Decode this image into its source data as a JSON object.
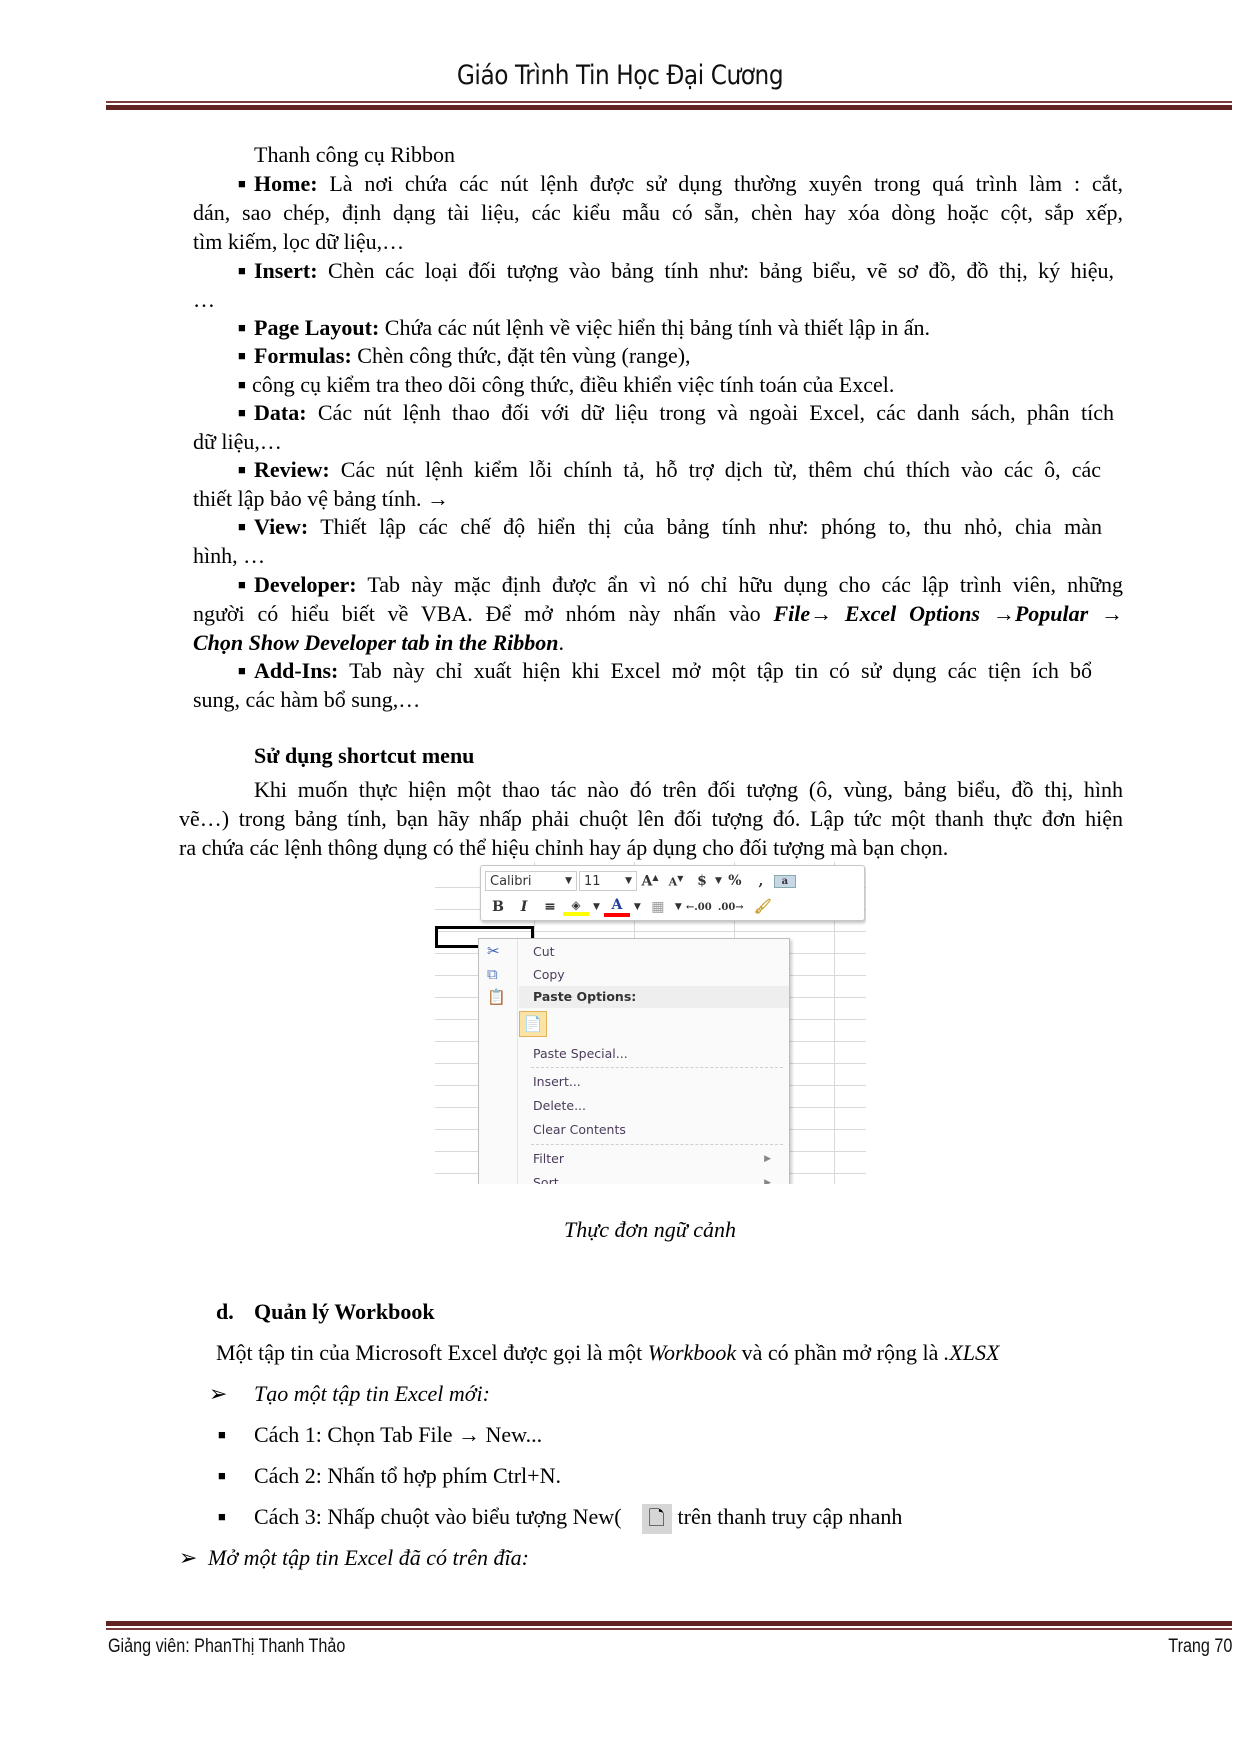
{
  "header": {
    "title": "Giáo Trình Tin Học Đại Cương"
  },
  "ribbon": {
    "heading": "Thanh công cụ Ribbon",
    "home": {
      "label": "Home:",
      "l1": "Là nơi chứa các nút lệnh được sử dụng thường xuyên trong quá trình làm : cắt,",
      "l2": "dán, sao chép, định dạng tài liệu, các kiểu mẫu có sẵn, chèn hay xóa dòng hoặc cột, sắp xếp,",
      "l3": "tìm kiếm, lọc dữ liệu,…"
    },
    "insert": {
      "label": "Insert:",
      "l1": "Chèn các loại đối tượng vào bảng tính như: bảng biểu, vẽ sơ đồ, đồ thị, ký hiệu,",
      "l2": "…"
    },
    "pagelayout": {
      "label": "Page Layout:",
      "l1": "Chứa các nút lệnh về việc hiển thị bảng tính và thiết lập in ấn."
    },
    "formulas": {
      "label": "Formulas:",
      "l1": "Chèn công thức, đặt tên vùng (range),"
    },
    "tools": {
      "l1": "công cụ kiểm tra theo dõi công thức, điều khiển việc tính toán của Excel."
    },
    "data": {
      "label": "Data:",
      "l1": "Các nút lệnh thao đối với dữ liệu trong và ngoài Excel, các danh sách, phân tích",
      "l2": "dữ liệu,…"
    },
    "review": {
      "label": "Review:",
      "l1": "Các nút lệnh kiểm lỗi chính tả, hỗ trợ dịch từ, thêm chú thích vào các ô, các",
      "l2": "thiết lập bảo vệ bảng tính. →"
    },
    "view": {
      "label": "View:",
      "l1": "Thiết lập các chế độ hiển thị của bảng tính như: phóng to, thu nhỏ, chia màn",
      "l2": "hình, …"
    },
    "developer": {
      "label": "Developer:",
      "l1": "Tab này mặc định được ẩn vì nó chỉ hữu dụng cho các lập trình viên, những",
      "l2a": "người có hiểu biết về VBA. Để mở nhóm này nhấn vào",
      "l2b": "File→ Excel Options →Popular →",
      "l3": "Chọn Show Developer tab in the Ribbon",
      "l3end": "."
    },
    "addins": {
      "label": "Add-Ins:",
      "l1": "Tab này chỉ xuất hiện khi Excel mở một tập tin có sử dụng các tiện ích bổ",
      "l2": "sung, các hàm bổ sung,…"
    }
  },
  "shortcut": {
    "heading": "Sử dụng shortcut menu",
    "l1": "Khi muốn thực hiện một thao tác nào đó trên đối tượng (ô, vùng, bảng biểu, đồ thị, hình",
    "l2": "vẽ…) trong bảng tính, bạn hãy nhấp phải chuột lên đối tượng đó. Lập tức một thanh thực đơn hiện",
    "l3": "ra chứa các lệnh thông dụng có thể hiệu chỉnh hay áp dụng cho đối tượng mà bạn chọn."
  },
  "excel": {
    "font": "Calibri",
    "size": "11",
    "menu": {
      "cut": "Cut",
      "copy": "Copy",
      "paste_options": "Paste Options:",
      "paste_special": "Paste Special...",
      "insert": "Insert...",
      "delete": "Delete...",
      "clear": "Clear Contents",
      "filter": "Filter",
      "sort": "Sort"
    },
    "colors": {
      "highlight": "#ffff00",
      "font_color": "#ff0000",
      "paste_icon_bg": "#fbe3a6"
    }
  },
  "caption": "Thực đơn ngữ cảnh",
  "workbook": {
    "heading_num": "d.",
    "heading": "Quản lý Workbook",
    "intro_a": "Một tập tin của Microsoft Excel được gọi là một",
    "intro_b": "Workbook",
    "intro_c": "và có phần mở rộng là",
    "intro_d": ".XLSX",
    "new_title": "Tạo một tập tin Excel mới:",
    "way1": "Cách 1: Chọn Tab File → New...",
    "way2": "Cách 2: Nhấn tổ hợp phím Ctrl+N.",
    "way3a": "Cách 3: Nhấp chuột vào biểu tượng New(",
    "way3b": "trên thanh truy cập nhanh",
    "open_title": "Mở một tập tin Excel đã có trên đĩa:"
  },
  "footer": {
    "author": "Giảng viên: PhanThị Thanh Thảo",
    "page": "Trang 70"
  },
  "theme": {
    "rule_color": "#622423"
  }
}
